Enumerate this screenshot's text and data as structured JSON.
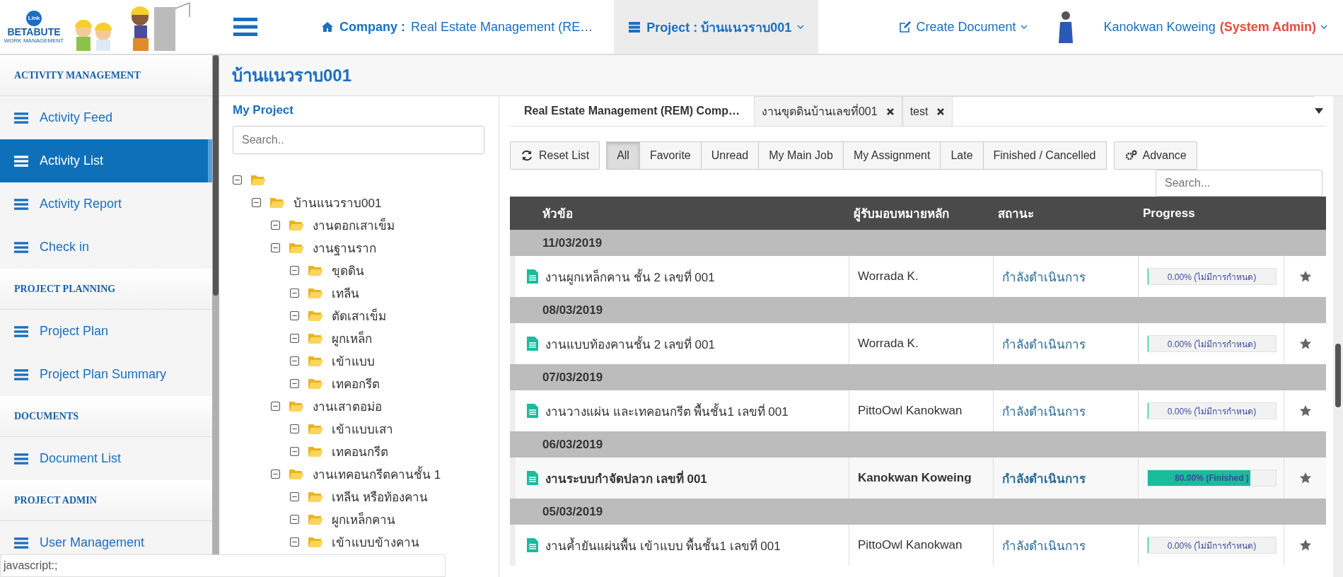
{
  "logo": {
    "badge": "Link",
    "brand": "BETABUTE",
    "tagline": "WORK MANAGEMENT"
  },
  "topbar": {
    "company_label": "Company :",
    "company_value": "Real Estate Management (RE…",
    "project_label": "Project : บ้านแนวราบ001",
    "project_selected": true,
    "create_document": "Create Document",
    "user_name": "Kanokwan Koweing",
    "user_role": "(System Admin)"
  },
  "sidebar": {
    "sections": [
      {
        "title": "ACTIVITY MANAGEMENT",
        "items": [
          {
            "label": "Activity Feed",
            "selected": false
          },
          {
            "label": "Activity List",
            "selected": true
          },
          {
            "label": "Activity Report",
            "selected": false
          },
          {
            "label": "Check in",
            "selected": false
          }
        ]
      },
      {
        "title": "PROJECT PLANNING",
        "items": [
          {
            "label": "Project Plan",
            "selected": false
          },
          {
            "label": "Project Plan Summary",
            "selected": false
          }
        ]
      },
      {
        "title": "DOCUMENTS",
        "items": [
          {
            "label": "Document List",
            "selected": false
          }
        ]
      },
      {
        "title": "PROJECT ADMIN",
        "items": [
          {
            "label": "User Management",
            "selected": false
          }
        ]
      }
    ]
  },
  "page_title": "บ้านแนวราบ001",
  "project_tree": {
    "title": "My Project",
    "search_placeholder": "Search..",
    "nodes": [
      {
        "expanded": true,
        "children": [
          {
            "label": "บ้านแนวราบ001",
            "expanded": true,
            "children": [
              {
                "label": "งานตอกเสาเข็ม",
                "expanded": true
              },
              {
                "label": "งานฐานราก",
                "expanded": true,
                "children": [
                  {
                    "label": "ขุดดิน",
                    "expanded": true
                  },
                  {
                    "label": "เทลีน",
                    "expanded": true
                  },
                  {
                    "label": "ตัดเสาเข็ม",
                    "expanded": true
                  },
                  {
                    "label": "ผูกเหล็ก",
                    "expanded": true
                  },
                  {
                    "label": "เข้าแบบ",
                    "expanded": true
                  },
                  {
                    "label": "เทคอกรีต",
                    "expanded": true
                  }
                ]
              },
              {
                "label": "งานเสาตอม่อ",
                "expanded": true,
                "children": [
                  {
                    "label": "เข้าแบบเสา",
                    "expanded": true
                  },
                  {
                    "label": "เทคอนกรีต",
                    "expanded": true
                  }
                ]
              },
              {
                "label": "งานเทคอนกรีตคานชั้น 1",
                "expanded": true,
                "children": [
                  {
                    "label": "เทลีน หรือท้องคาน",
                    "expanded": true
                  },
                  {
                    "label": "ผูกเหล็กคาน",
                    "expanded": true
                  },
                  {
                    "label": "เข้าแบบข้างคาน",
                    "expanded": true
                  }
                ]
              }
            ]
          }
        ]
      }
    ]
  },
  "doc_tabs": [
    {
      "label": "Real Estate Management (REM) Comp…",
      "selected": true,
      "closable": false
    },
    {
      "label": "งานขุดดินบ้านเลขที่001",
      "selected": false,
      "closable": true
    },
    {
      "label": "test",
      "selected": false,
      "closable": true
    }
  ],
  "toolbar": {
    "reset": "Reset List",
    "advance": "Advance",
    "search_placeholder": "Search...",
    "filters": [
      {
        "label": "All",
        "selected": true
      },
      {
        "label": "Favorite",
        "selected": false
      },
      {
        "label": "Unread",
        "selected": false
      },
      {
        "label": "My Main Job",
        "selected": false
      },
      {
        "label": "My Assignment",
        "selected": false
      },
      {
        "label": "Late",
        "selected": false
      },
      {
        "label": "Finished / Cancelled",
        "selected": false
      }
    ]
  },
  "table": {
    "columns": [
      "หัวข้อ",
      "ผู้รับมอบหมายหลัก",
      "สถานะ",
      "Progress"
    ],
    "groups": [
      {
        "date": "11/03/2019",
        "rows": [
          {
            "title": "งานผูกเหล็กคาน ชั้น 2 เลขที่ 001",
            "assignee": "Worrada K.",
            "status": "กำลังดำเนินการ",
            "level": 0,
            "progress": "0.00% (ไม่มีการกำหนด)",
            "unread": false
          }
        ]
      },
      {
        "date": "08/03/2019",
        "rows": [
          {
            "title": "งานแบบท้องคานชั้น 2 เลขที่ 001",
            "assignee": "Worrada K.",
            "status": "กำลังดำเนินการ",
            "level": 0,
            "progress": "0.00% (ไม่มีการกำหนด)",
            "unread": false
          }
        ]
      },
      {
        "date": "07/03/2019",
        "rows": [
          {
            "title": "งานวางแผ่น และเทคอนกรีต พื้นชั้น1 เลขที่ 001",
            "assignee": "PittoOwl Kanokwan",
            "status": "กำลังดำเนินการ",
            "level": 0,
            "progress": "0.00% (ไม่มีการกำหนด)",
            "unread": false
          }
        ]
      },
      {
        "date": "06/03/2019",
        "rows": [
          {
            "title": "งานระบบกำจัดปลวก เลขที่ 001",
            "assignee": "Kanokwan Koweing",
            "status": "กำลังดำเนินการ",
            "level": 0.8,
            "progress": "80.00% (Finished )",
            "unread": true
          }
        ]
      },
      {
        "date": "05/03/2019",
        "rows": [
          {
            "title": "งานค้ำยันแผ่นพื้น เข้าแบบ พื้นชั้น1 เลขที่ 001",
            "assignee": "PittoOwl Kanokwan",
            "status": "กำลังดำเนินการ",
            "level": 0,
            "progress": "0.00% (ไม่มีการกำหนด)",
            "unread": false
          }
        ]
      }
    ]
  },
  "status_bar": "javascript:;"
}
